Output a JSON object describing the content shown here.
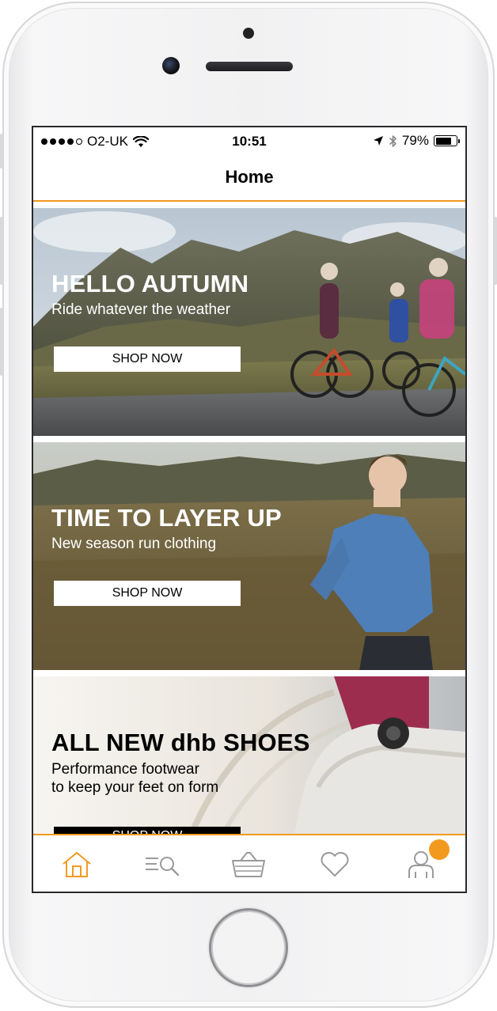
{
  "status": {
    "carrier": "O2-UK",
    "time": "10:51",
    "battery": "79%",
    "battery_level": 0.79,
    "icons": [
      "signal-dots-icon",
      "wifi-icon",
      "location-arrow-icon",
      "bluetooth-icon",
      "battery-icon"
    ]
  },
  "nav": {
    "title": "Home"
  },
  "banners": [
    {
      "title": "HELLO AUTUMN",
      "subtitle": "Ride whatever the weather",
      "button": "SHOP NOW"
    },
    {
      "title": "TIME TO LAYER UP",
      "subtitle": "New season run clothing",
      "button": "SHOP NOW"
    },
    {
      "title": "ALL NEW dhb SHOES",
      "subtitle_line1": "Performance footwear",
      "subtitle_line2": "to keep your feet on form",
      "button": "SHOP NOW"
    }
  ],
  "tabs": [
    {
      "icon": "home-icon",
      "active": true
    },
    {
      "icon": "search-list-icon",
      "active": false
    },
    {
      "icon": "basket-icon",
      "active": false
    },
    {
      "icon": "heart-icon",
      "active": false
    },
    {
      "icon": "account-icon",
      "active": false
    }
  ],
  "colors": {
    "accent": "#f29a1f",
    "inactive_icon": "#9a9a9a"
  }
}
